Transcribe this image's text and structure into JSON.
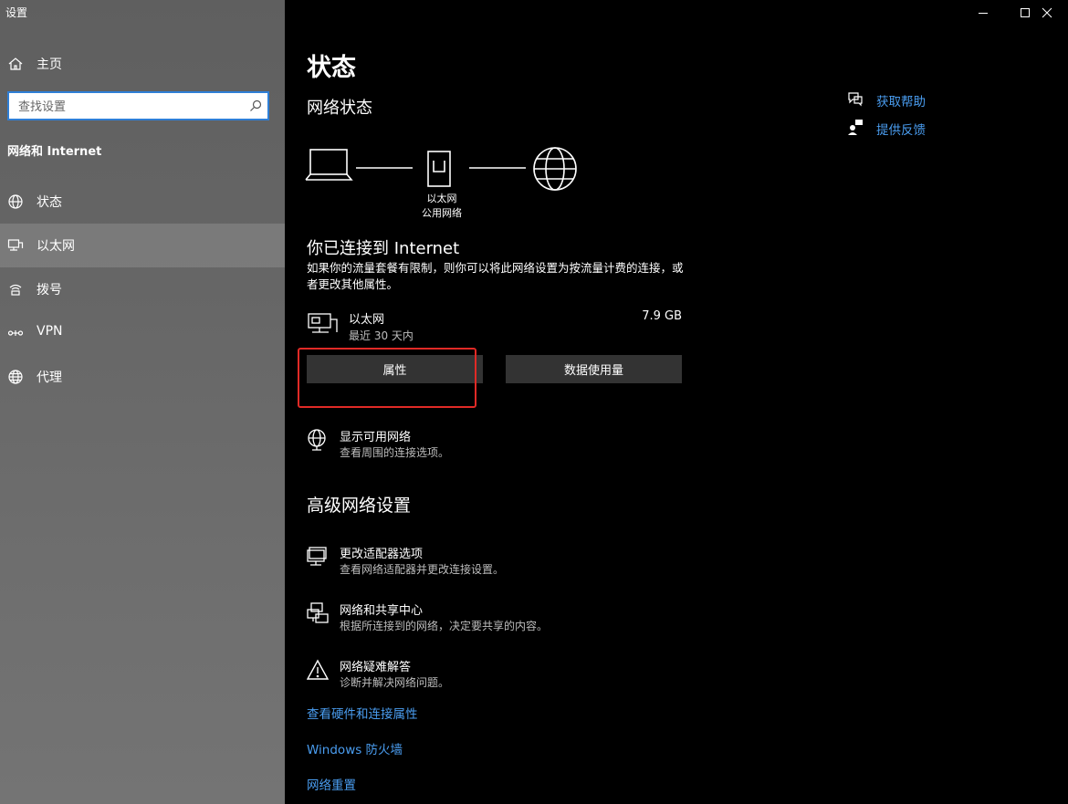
{
  "window": {
    "title": "设置"
  },
  "sidebar": {
    "home_label": "主页",
    "search_placeholder": "查找设置",
    "section_label": "网络和 Internet",
    "items": [
      {
        "label": "状态",
        "icon": "globe-icon"
      },
      {
        "label": "以太网",
        "icon": "ethernet-icon",
        "selected": true
      },
      {
        "label": "拨号",
        "icon": "dialup-icon"
      },
      {
        "label": "VPN",
        "icon": "vpn-icon"
      },
      {
        "label": "代理",
        "icon": "proxy-globe-icon"
      }
    ]
  },
  "main": {
    "title": "状态",
    "network_status_heading": "网络状态",
    "diagram_caption_1": "以太网",
    "diagram_caption_2": "公用网络",
    "connected_heading": "你已连接到 Internet",
    "connected_desc": "如果你的流量套餐有限制，则你可以将此网络设置为按流量计费的连接，或者更改其他属性。",
    "connection": {
      "name": "以太网",
      "period": "最近 30 天内",
      "usage": "7.9 GB"
    },
    "properties_button": "属性",
    "data_usage_button": "数据使用量",
    "show_networks": {
      "title": "显示可用网络",
      "desc": "查看周围的连接选项。"
    },
    "advanced_heading": "高级网络设置",
    "advanced_items": [
      {
        "title": "更改适配器选项",
        "desc": "查看网络适配器并更改连接设置。"
      },
      {
        "title": "网络和共享中心",
        "desc": "根据所连接到的网络，决定要共享的内容。"
      },
      {
        "title": "网络疑难解答",
        "desc": "诊断并解决网络问题。"
      }
    ],
    "links": [
      "查看硬件和连接属性",
      "Windows 防火墙",
      "网络重置"
    ]
  },
  "help": {
    "get_help": "获取帮助",
    "feedback": "提供反馈"
  },
  "colors": {
    "accent": "#4a9df0",
    "highlight_box": "#e02a26",
    "button_bg": "#333333"
  }
}
